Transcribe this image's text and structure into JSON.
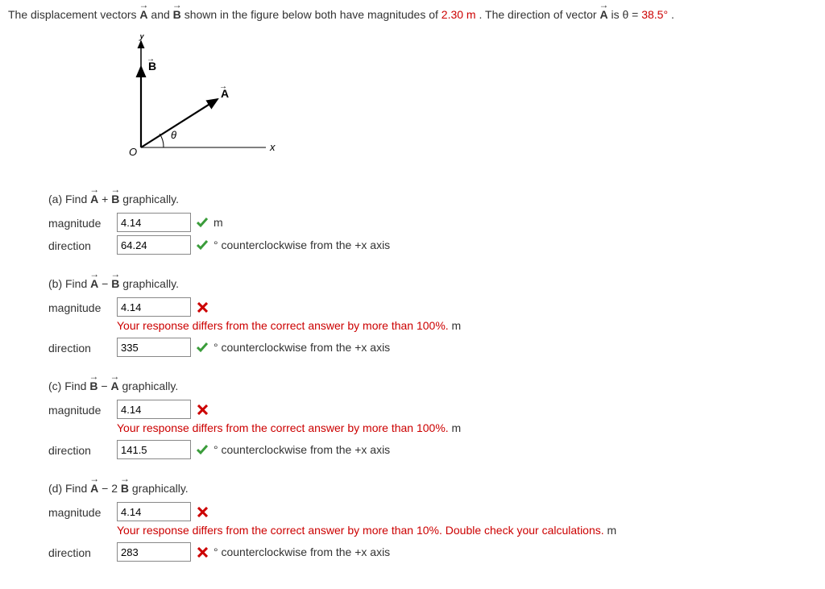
{
  "problem": {
    "prefix": "The displacement vectors ",
    "vA": "A",
    "mid1": " and ",
    "vB": "B",
    "mid2": " shown in the figure below both have magnitudes of ",
    "magnitude": "2.30 m",
    "mid3": ". The direction of vector ",
    "vA2": "A",
    "mid4": " is  θ = ",
    "angle": "38.5°",
    "suffix": "."
  },
  "figure": {
    "yLabel": "y",
    "xLabel": "x",
    "origin": "O",
    "vecA": "A",
    "vecB": "B",
    "theta": "θ"
  },
  "labels": {
    "magnitude": "magnitude",
    "direction": "direction",
    "ccw": "° counterclockwise from the +x axis",
    "m": "m"
  },
  "parts": {
    "a": {
      "title_pre": "(a) Find ",
      "title_mid": " + ",
      "title_suf": " graphically.",
      "mag_value": "4.14",
      "mag_correct": true,
      "dir_value": "64.24",
      "dir_correct": true
    },
    "b": {
      "title_pre": "(b) Find ",
      "title_mid": " − ",
      "title_suf": " graphically.",
      "mag_value": "4.14",
      "mag_correct": false,
      "mag_feedback": "Your response differs from the correct answer by more than 100%.",
      "dir_value": "335",
      "dir_correct": true
    },
    "c": {
      "title_pre": "(c) Find ",
      "title_mid": " − ",
      "title_suf": " graphically.",
      "mag_value": "4.14",
      "mag_correct": false,
      "mag_feedback": "Your response differs from the correct answer by more than 100%.",
      "dir_value": "141.5",
      "dir_correct": true
    },
    "d": {
      "title_pre": "(d) Find ",
      "title_mid": " − 2",
      "title_suf": " graphically.",
      "mag_value": "4.14",
      "mag_correct": false,
      "mag_feedback": "Your response differs from the correct answer by more than 10%. Double check your calculations.",
      "dir_value": "283",
      "dir_correct": false
    }
  }
}
